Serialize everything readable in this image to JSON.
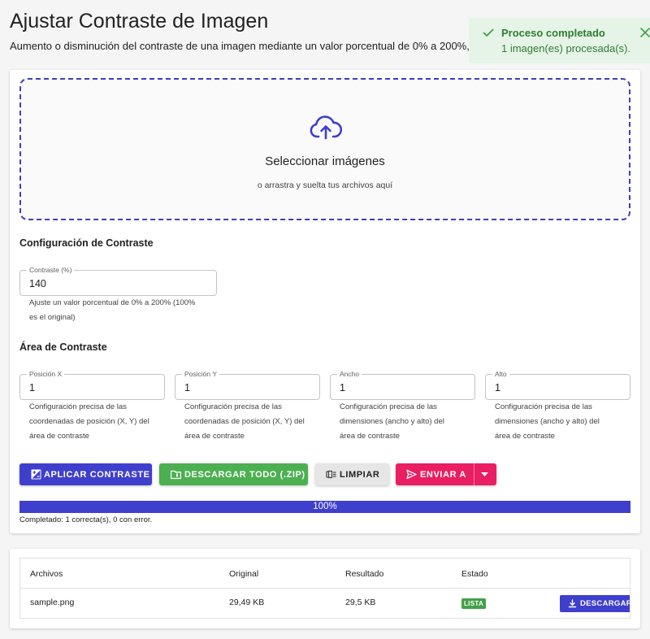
{
  "page": {
    "title": "Ajustar Contraste de Imagen",
    "subtitle": "Aumento o disminución del contraste de una imagen mediante un valor porcentual de 0% a 200%, de"
  },
  "toast": {
    "title": "Proceso completado",
    "message": "1 imagen(es) procesada(s).",
    "color": "#2e7d32"
  },
  "dropzone": {
    "title": "Seleccionar imágenes",
    "subtitle": "o arrastra y suelta tus archivos aquí",
    "icon": "cloud-upload-icon"
  },
  "contrast_config": {
    "section_title": "Configuración de Contraste",
    "field": {
      "label": "Contraste (%)",
      "value": "140",
      "helper_line1": "Ajuste un valor porcentual de 0% a 200% (100%",
      "helper_line2": "es el original)"
    }
  },
  "contrast_area": {
    "section_title": "Área de Contraste",
    "fields": [
      {
        "label": "Posición X",
        "value": "1",
        "helper": [
          "Configuración precisa de las",
          "coordenadas de posición (X, Y) del",
          "área de contraste"
        ]
      },
      {
        "label": "Posición Y",
        "value": "1",
        "helper": [
          "Configuración precisa de las",
          "coordenadas de posición (X, Y) del",
          "área de contraste"
        ]
      },
      {
        "label": "Ancho",
        "value": "1",
        "helper": [
          "Configuración precisa de las",
          "dimensiones (ancho y alto) del",
          "área de contraste"
        ]
      },
      {
        "label": "Alto",
        "value": "1",
        "helper": [
          "Configuración precisa de las",
          "dimensiones (ancho y alto) del",
          "área de contraste"
        ]
      }
    ]
  },
  "actions": {
    "apply": {
      "label": "APLICAR CONTRASTE",
      "color": "#3f3fce"
    },
    "download_all": {
      "label": "DESCARGAR TODO (.ZIP)",
      "color": "#4caf50"
    },
    "clear": {
      "label": "LIMPIAR",
      "color": "#e0e0e0"
    },
    "send_to": {
      "label": "ENVIAR A",
      "color": "#e91e63"
    }
  },
  "progress": {
    "value": 100,
    "label": "100%",
    "status": "Completado: 1 correcta(s), 0 con error."
  },
  "table": {
    "headers": [
      "Archivos",
      "Original",
      "Resultado",
      "Estado"
    ],
    "rows": [
      {
        "file": "sample.png",
        "original": "29,49 KB",
        "result": "29,5 KB",
        "status": "LISTA",
        "action": "DESCARGAR"
      }
    ]
  }
}
